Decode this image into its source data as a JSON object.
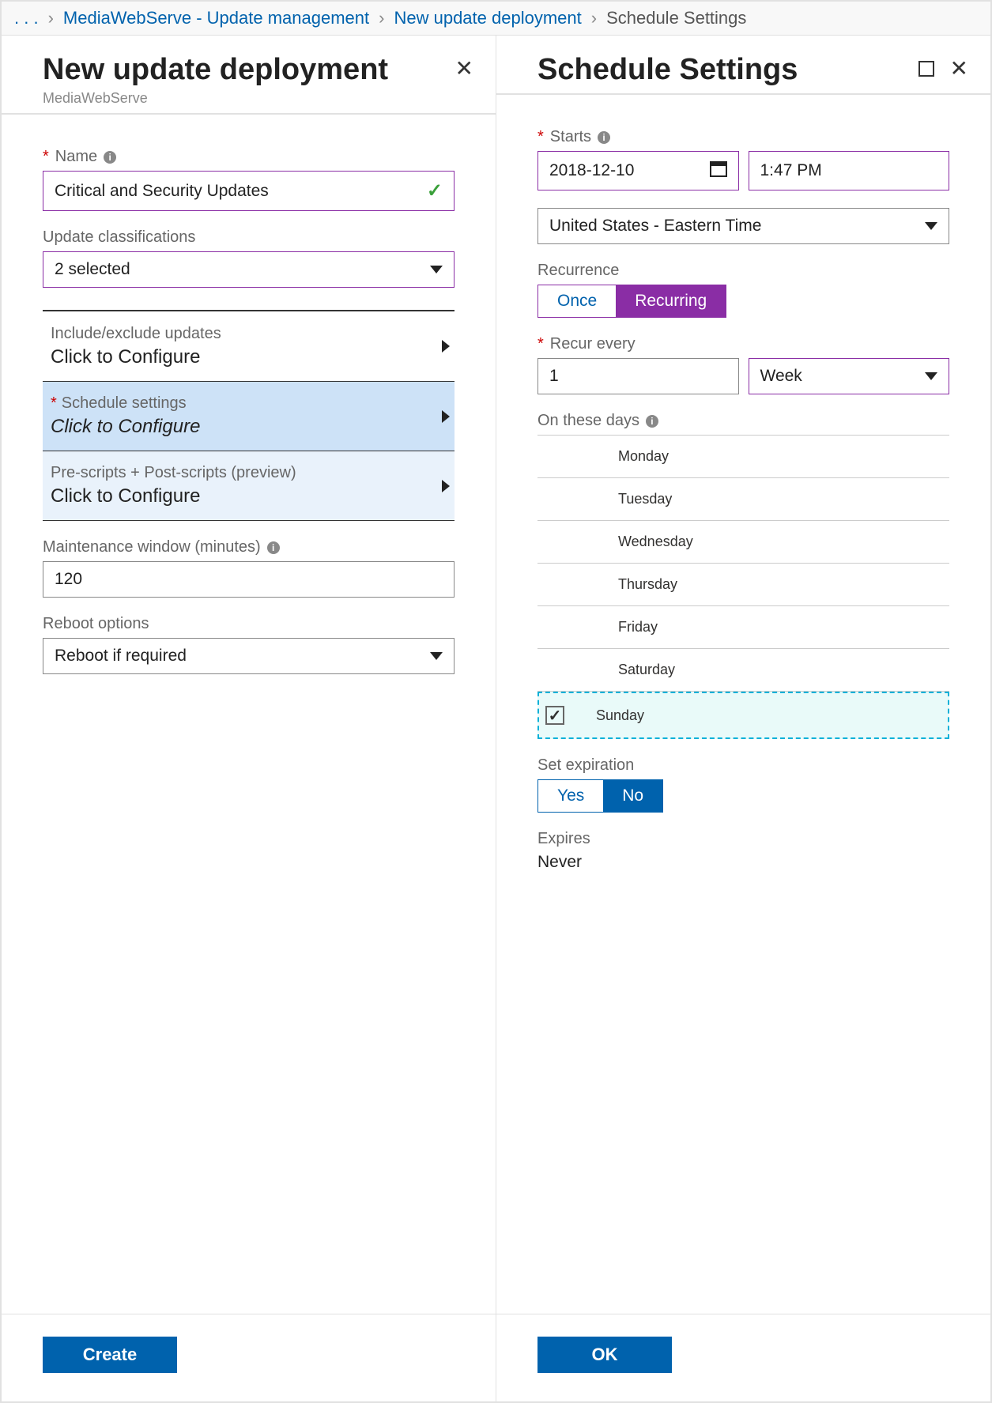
{
  "breadcrumb": {
    "dots": ". . .",
    "a": "MediaWebServe - Update management",
    "b": "New update deployment",
    "c": "Schedule Settings"
  },
  "left": {
    "title": "New update deployment",
    "subtitle": "MediaWebServe",
    "name_label": "Name",
    "name_value": "Critical and Security Updates",
    "classifications_label": "Update classifications",
    "classifications_value": "2 selected",
    "include_label": "Include/exclude updates",
    "include_value": "Click to Configure",
    "schedule_label": "Schedule settings",
    "schedule_value": "Click to Configure",
    "scripts_label": "Pre-scripts + Post-scripts (preview)",
    "scripts_value": "Click to Configure",
    "maint_label": "Maintenance window (minutes)",
    "maint_value": "120",
    "reboot_label": "Reboot options",
    "reboot_value": "Reboot if required",
    "create_btn": "Create"
  },
  "right": {
    "title": "Schedule Settings",
    "starts_label": "Starts",
    "start_date": "2018-12-10",
    "start_time": "1:47 PM",
    "timezone": "United States - Eastern Time",
    "recurrence_label": "Recurrence",
    "once": "Once",
    "recurring": "Recurring",
    "recur_label": "Recur every",
    "recur_n": "1",
    "recur_unit": "Week",
    "days_label": "On these days",
    "days": {
      "mon": "Monday",
      "tue": "Tuesday",
      "wed": "Wednesday",
      "thu": "Thursday",
      "fri": "Friday",
      "sat": "Saturday",
      "sun": "Sunday"
    },
    "sun_checked": "✓",
    "setexp_label": "Set expiration",
    "yes": "Yes",
    "no": "No",
    "expires_label": "Expires",
    "expires_value": "Never",
    "ok_btn": "OK"
  }
}
